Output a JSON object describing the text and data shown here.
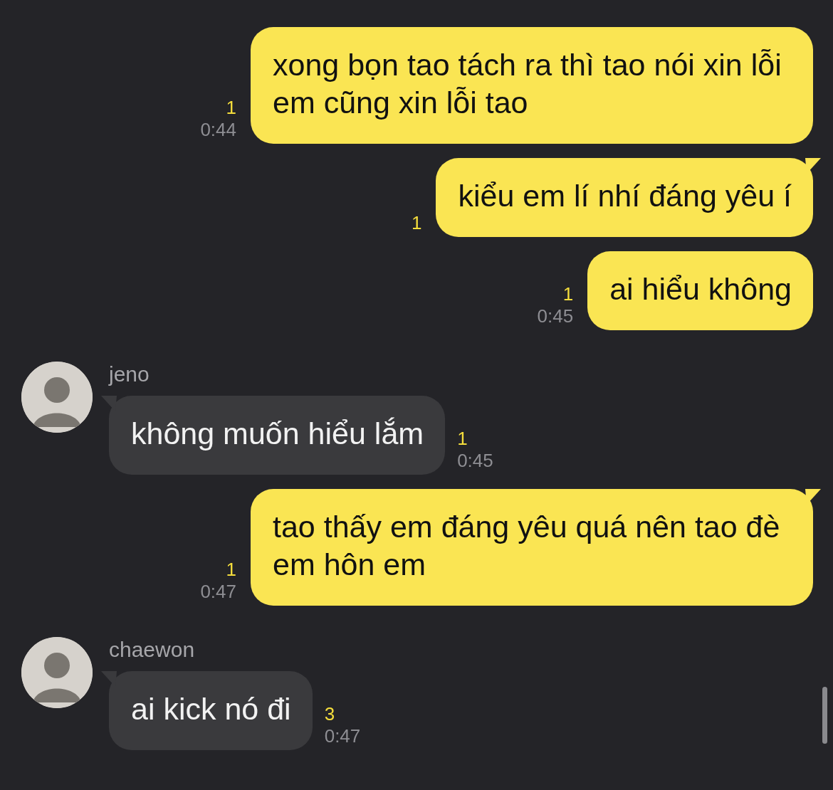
{
  "messages": [
    {
      "kind": "outgoing",
      "text": "xong bọn tao tách ra thì tao nói xin lỗi em cũng xin lỗi tao",
      "tail": false,
      "unread": "1",
      "time": "0:44"
    },
    {
      "kind": "outgoing",
      "text": "kiểu em lí nhí đáng yêu í",
      "tail": true,
      "unread": "1"
    },
    {
      "kind": "outgoing",
      "text": "ai hiểu không",
      "tail": false,
      "unread": "1",
      "time": "0:45"
    },
    {
      "kind": "incoming",
      "sender": "jeno",
      "text": "không muốn hiểu lắm",
      "tail": true,
      "unread": "1",
      "time": "0:45"
    },
    {
      "kind": "outgoing",
      "text": "tao thấy em đáng yêu quá nên tao đè em hôn em",
      "tail": true,
      "unread": "1",
      "time": "0:47"
    },
    {
      "kind": "incoming",
      "sender": "chaewon",
      "text": "ai kick nó đi",
      "tail": true,
      "unread": "3",
      "time": "0:47"
    }
  ]
}
